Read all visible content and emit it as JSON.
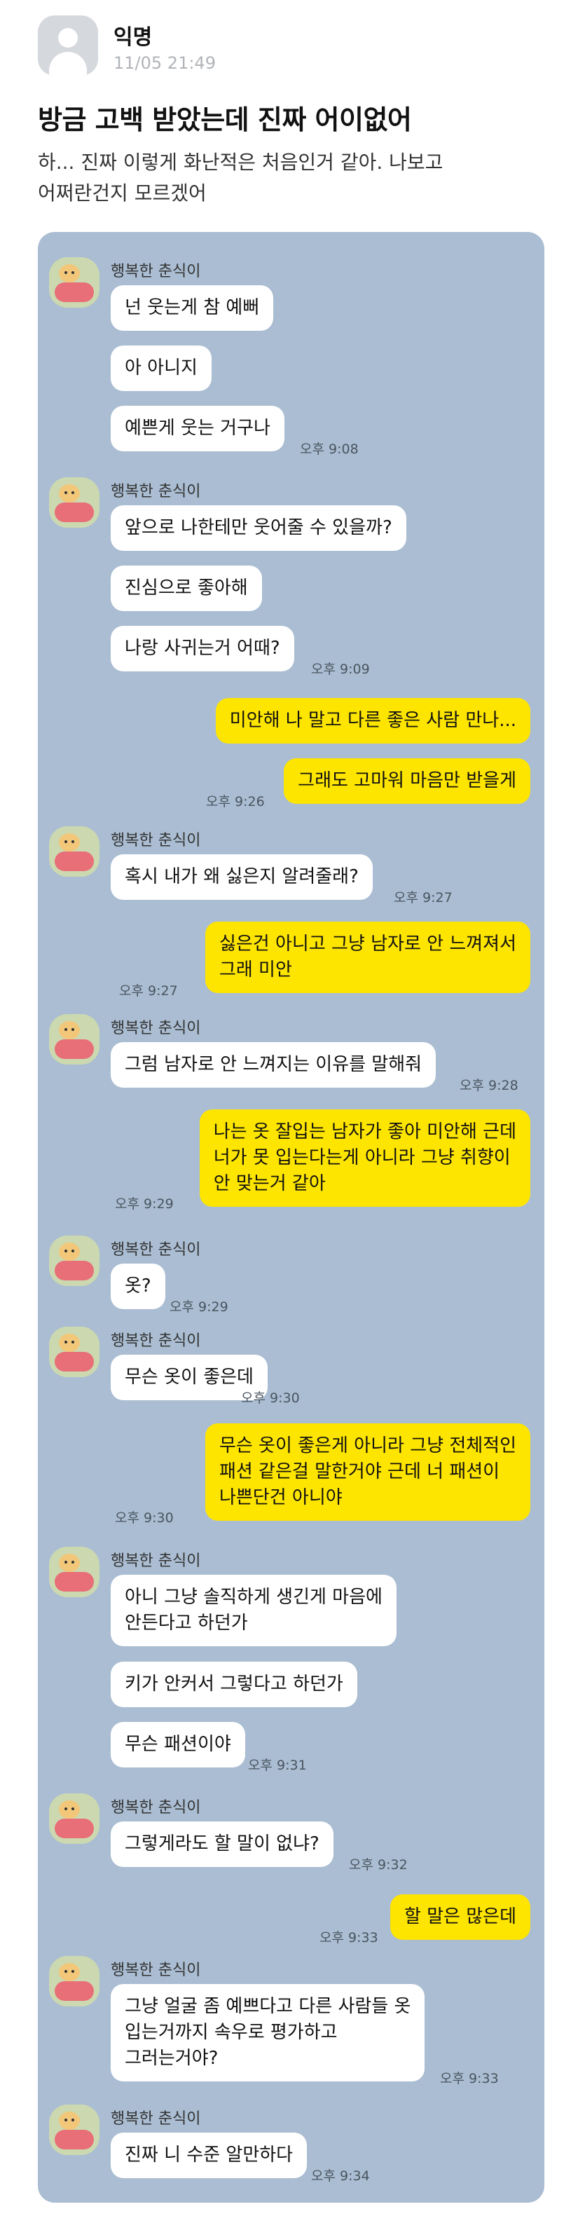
{
  "post": {
    "author": "익명",
    "timestamp": "11/05 21:49",
    "title": "방금 고백 받았는데 진짜 어이없어",
    "body": "하... 진짜 이렇게 화난적은 처음인거 같아. 나보고\n어쩌란건지 모르겠어"
  },
  "chat": {
    "sender_name": "행복한 춘식이",
    "messages": [
      {
        "text": "넌 웃는게 참 예뻐"
      },
      {
        "text": "아 아니지"
      },
      {
        "text": "예쁜게 웃는 거구나",
        "time": "오후 9:08"
      },
      {
        "text": "앞으로 나한테만 웃어줄 수 있을까?"
      },
      {
        "text": "진심으로 좋아해"
      },
      {
        "text": "나랑 사귀는거 어때?",
        "time": "오후 9:09"
      },
      {
        "text": "미안해 나 말고 다른 좋은 사람 만나..."
      },
      {
        "text": "그래도 고마워 마음만 받을게",
        "time": "오후 9:26"
      },
      {
        "text": "혹시 내가 왜 싫은지 알려줄래?",
        "time": "오후 9:27"
      },
      {
        "text": "싫은건 아니고 그냥 남자로 안 느껴져서\n그래 미안",
        "time": "오후 9:27"
      },
      {
        "text": "그럼 남자로 안 느껴지는 이유를 말해줘",
        "time": "오후 9:28"
      },
      {
        "text": "나는 옷 잘입는 남자가 좋아 미안해 근데\n너가 못 입는다는게 아니라 그냥 취향이\n안 맞는거 같아",
        "time": "오후 9:29"
      },
      {
        "text": "옷?",
        "time": "오후 9:29"
      },
      {
        "text": "무슨 옷이 좋은데",
        "time": "오후 9:30"
      },
      {
        "text": "무슨 옷이 좋은게 아니라 그냥 전체적인\n패션 같은걸 말한거야 근데 너 패션이\n나쁜단건 아니야",
        "time": "오후 9:30"
      },
      {
        "text": "아니 그냥 솔직하게 생긴게 마음에\n안든다고 하던가"
      },
      {
        "text": "키가 안커서 그렇다고 하던가"
      },
      {
        "text": "무슨 패션이야",
        "time": "오후 9:31"
      },
      {
        "text": "그렇게라도 할 말이 없냐?",
        "time": "오후 9:32"
      },
      {
        "text": "할 말은 많은데",
        "time": "오후 9:33"
      },
      {
        "text": "그냥 얼굴 좀 예쁘다고 다른 사람들 옷\n입는거까지 속우로 평가하고\n그러는거야?",
        "time": "오후 9:33"
      },
      {
        "text": "진짜 니 수준 알만하다",
        "time": "오후 9:34"
      }
    ]
  }
}
